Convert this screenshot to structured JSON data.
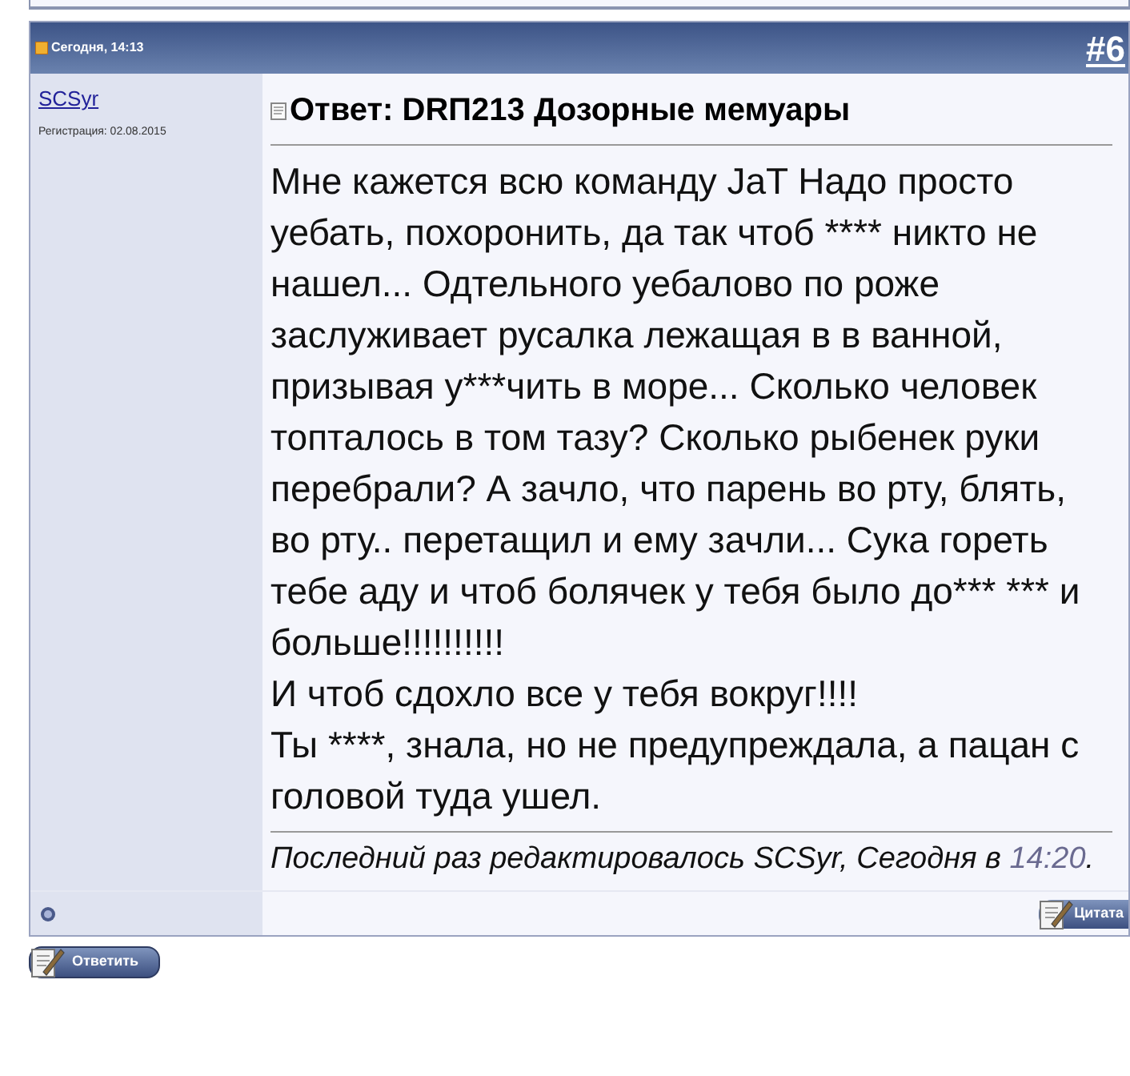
{
  "post": {
    "date": "Сегодня, 14:13",
    "number": "#6",
    "author": {
      "name": "SCSyr",
      "registered": "Регистрация: 02.08.2015"
    },
    "title": "Ответ: DRП213 Дозорные мемуары",
    "paragraphs": [
      "Мне кажется всю команду JaT Надо просто уебать, похоронить, да так чтоб **** никто не нашел... Одтельного уебалово по роже заслуживает русалка лежащая в в ванной, призывая у***чить в море... Сколько человек топталось в том тазу? Сколько рыбенек руки перебрали? А зачло, что парень во рту, блять, во рту.. перетащил и ему зачли... Сука гореть тебе аду и чтоб болячек у тебя было до*** *** и больше!!!!!!!!!!",
      "И чтоб сдохло все у тебя вокруг!!!!",
      "Ты ****, знала, но не предупреждала, а пацан с головой туда ушел."
    ],
    "edited": {
      "text": "Последний раз редактировалось SCSyr, Сегодня в",
      "time": "14:20",
      "end": "."
    },
    "quote_button": "Цитата"
  },
  "reply_button": "Ответить"
}
